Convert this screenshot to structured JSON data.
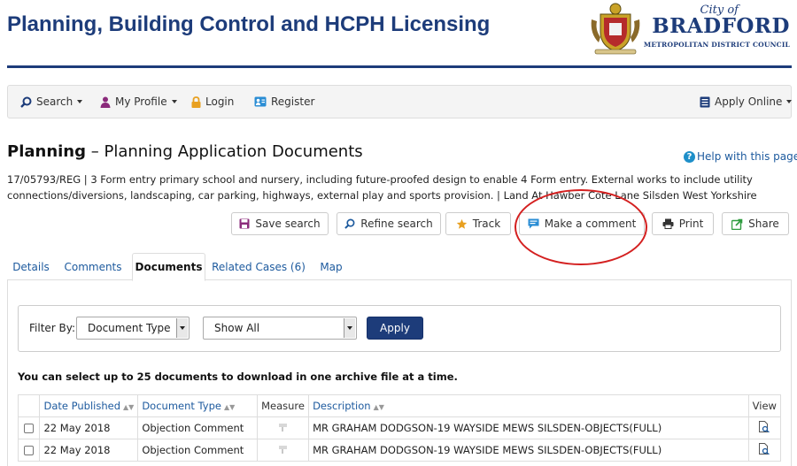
{
  "header": {
    "title": "Planning, Building Control and HCPH Licensing",
    "brand_city": "City of",
    "brand_name": "BRADFORD",
    "brand_sub": "METROPOLITAN DISTRICT COUNCIL"
  },
  "nav": {
    "search": "Search",
    "my_profile": "My Profile",
    "login": "Login",
    "register": "Register",
    "apply_online": "Apply Online"
  },
  "page": {
    "heading_bold": "Planning",
    "heading_rest": " – Planning Application Documents",
    "help": "Help with this page",
    "summary": "17/05793/REG | 3 Form entry primary school and nursery, including future-proofed design to enable 4 Form entry. External works to include utility connections/diversions, landscaping, car parking, highways, external play and sports provision. | Land At Hawber Cote Lane Silsden West Yorkshire"
  },
  "actions": {
    "save_search": "Save search",
    "refine_search": "Refine search",
    "track": "Track",
    "make_comment": "Make a comment",
    "print": "Print",
    "share": "Share"
  },
  "tabs": [
    "Details",
    "Comments",
    "Documents",
    "Related Cases (6)",
    "Map"
  ],
  "filter": {
    "label": "Filter By:",
    "type_value": "Document Type",
    "show_value": "Show All",
    "apply": "Apply"
  },
  "select_note": "You can select up to 25 documents to download in one archive file at a time.",
  "table": {
    "headers": {
      "date": "Date Published",
      "type": "Document Type",
      "measure": "Measure",
      "description": "Description",
      "view": "View"
    },
    "rows": [
      {
        "date": "22 May 2018",
        "type": "Objection Comment",
        "description": "MR GRAHAM DODGSON-19 WAYSIDE MEWS SILSDEN-OBJECTS(FULL)"
      },
      {
        "date": "22 May 2018",
        "type": "Objection Comment",
        "description": "MR GRAHAM DODGSON-19 WAYSIDE MEWS SILSDEN-OBJECTS(FULL)"
      }
    ]
  },
  "colors": {
    "brand": "#1d3c7a",
    "link": "#1d5a9e",
    "annotation": "#d42020"
  }
}
